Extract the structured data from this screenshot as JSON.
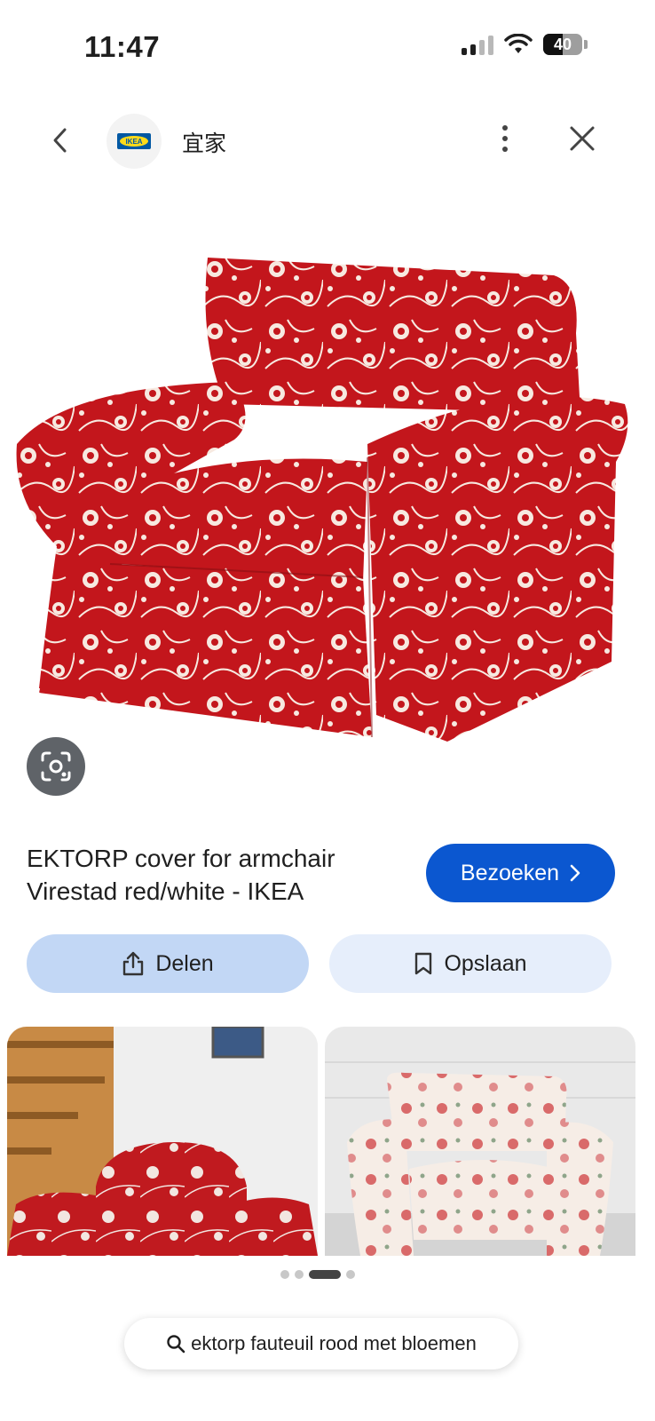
{
  "status_bar": {
    "time": "11:47",
    "battery": "40"
  },
  "header": {
    "site_name": "宜家",
    "logo_text": "IKEA"
  },
  "result": {
    "title_line1": "EKTORP cover for armchair",
    "title_line2": "Virestad red/white - IKEA",
    "visit_label": "Bezoeken"
  },
  "actions": {
    "share_label": "Delen",
    "save_label": "Opslaan"
  },
  "search": {
    "query": "ektorp fauteuil rood met bloemen"
  },
  "carousel": {
    "page_count": 4,
    "active_index": 2
  },
  "colors": {
    "accent": "#0b57d0",
    "share_bg": "#c2d7f5",
    "save_bg": "#e6eefb",
    "chair_red": "#c3161c"
  }
}
